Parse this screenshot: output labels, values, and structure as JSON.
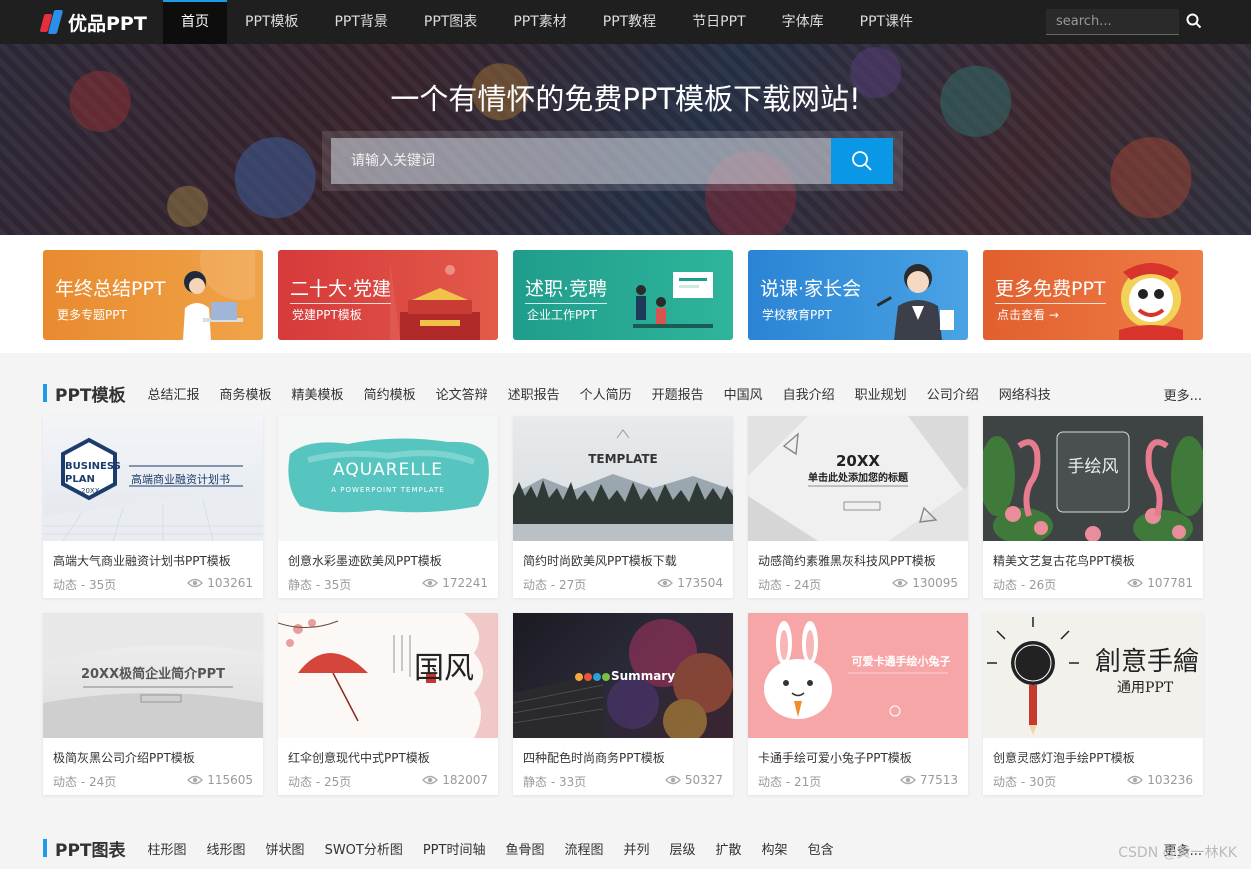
{
  "nav": {
    "logo": "优品PPT",
    "items": [
      "首页",
      "PPT模板",
      "PPT背景",
      "PPT图表",
      "PPT素材",
      "PPT教程",
      "节日PPT",
      "字体库",
      "PPT课件"
    ],
    "search_placeholder": "search..."
  },
  "hero": {
    "title": "一个有情怀的免费PPT模板下载网站!",
    "search_placeholder": "请输入关键词"
  },
  "categories": [
    {
      "title": "年终总结PPT",
      "sub": "更多专题PPT",
      "color": "#e98a2f"
    },
    {
      "title": "二十大·党建",
      "sub": "党建PPT模板",
      "color": "#d63a3a"
    },
    {
      "title": "述职·竞聘",
      "sub": "企业工作PPT",
      "color": "#1f9d8c"
    },
    {
      "title": "说课·家长会",
      "sub": "学校教育PPT",
      "color": "#2a84d4"
    },
    {
      "title": "更多免费PPT",
      "sub": "点击查看 →",
      "color": "#e15f2e"
    }
  ],
  "section1": {
    "title": "PPT模板",
    "tags": [
      "总结汇报",
      "商务模板",
      "精美模板",
      "简约模板",
      "论文答辩",
      "述职报告",
      "个人简历",
      "开题报告",
      "中国风",
      "自我介绍",
      "职业规划",
      "公司介绍",
      "网络科技"
    ],
    "more": "更多..."
  },
  "cards": [
    {
      "title": "高端大气商业融资计划书PPT模板",
      "meta": "动态 - 35页",
      "views": "103261",
      "thumb_text": "BUSINESS PLAN",
      "thumb_sub": "高端商业融资计划书",
      "year": "20XX"
    },
    {
      "title": "创意水彩墨迹欧美风PPT模板",
      "meta": "静态 - 35页",
      "views": "172241",
      "thumb_text": "AQUARELLE",
      "thumb_sub": "A POWERPOINT TEMPLATE"
    },
    {
      "title": "简约时尚欧美风PPT模板下载",
      "meta": "动态 - 27页",
      "views": "173504",
      "thumb_text": "TEMPLATE"
    },
    {
      "title": "动感简约素雅黑灰科技风PPT模板",
      "meta": "动态 - 24页",
      "views": "130095",
      "thumb_text": "20XX",
      "thumb_sub": "单击此处添加您的标题"
    },
    {
      "title": "精美文艺复古花鸟PPT模板",
      "meta": "动态 - 26页",
      "views": "107781",
      "thumb_text": "手绘风"
    },
    {
      "title": "极简灰黑公司介绍PPT模板",
      "meta": "动态 - 24页",
      "views": "115605",
      "thumb_text": "20XX极简企业简介PPT"
    },
    {
      "title": "红伞创意现代中式PPT模板",
      "meta": "动态 - 25页",
      "views": "182007",
      "thumb_text": "国风"
    },
    {
      "title": "四种配色时尚商务PPT模板",
      "meta": "静态 - 33页",
      "views": "50327",
      "thumb_text": "Summary"
    },
    {
      "title": "卡通手绘可爱小兔子PPT模板",
      "meta": "动态 - 21页",
      "views": "77513",
      "thumb_text": "可爱卡通手绘小兔子"
    },
    {
      "title": "创意灵感灯泡手绘PPT模板",
      "meta": "动态 - 30页",
      "views": "103236",
      "thumb_text": "創意手繪",
      "thumb_sub": "通用PPT"
    }
  ],
  "section2": {
    "title": "PPT图表",
    "tags": [
      "柱形图",
      "线形图",
      "饼状图",
      "SWOT分析图",
      "PPT时间轴",
      "鱼骨图",
      "流程图",
      "并列",
      "层级",
      "扩散",
      "构架",
      "包含"
    ],
    "more": "更多..."
  },
  "watermark": "CSDN @黄一林KK"
}
